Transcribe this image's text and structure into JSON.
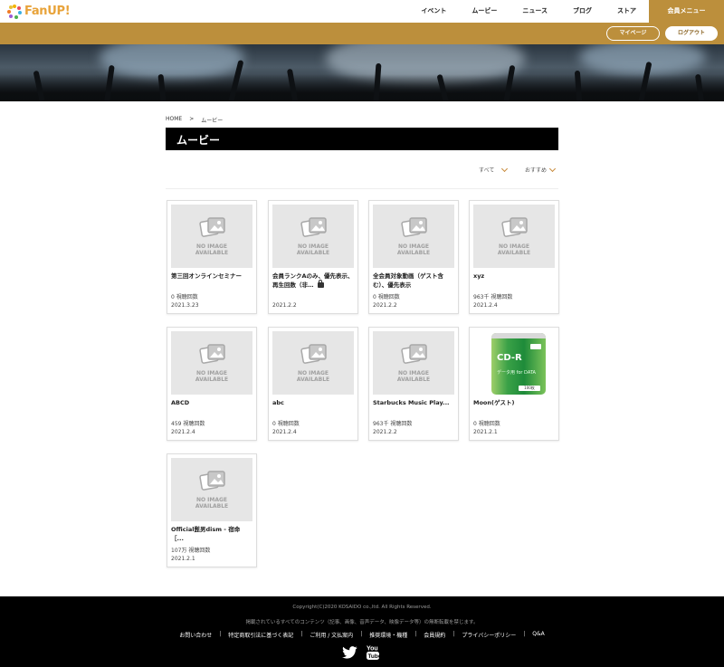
{
  "header": {
    "logo_text": "FanUP!",
    "nav": [
      "イベント",
      "ムービー",
      "ニュース",
      "ブログ",
      "ストア"
    ],
    "member_menu": "会員メニュー",
    "mypage": "マイページ",
    "logout": "ログアウト"
  },
  "breadcrumb": {
    "home": "HOME",
    "sep": ">",
    "current": "ムービー"
  },
  "page_title": "ムービー",
  "filters": {
    "category": "すべて",
    "sort": "おすすめ"
  },
  "no_image": {
    "line1": "NO IMAGE",
    "line2": "AVAILABLE"
  },
  "cards": [
    {
      "title": "第三回オンラインセミナー",
      "views": "0 視聴回数",
      "date": "2021.3.23"
    },
    {
      "title": "会員ランクAのみ、優先表示、再生回数（非…",
      "views": "",
      "date": "2021.2.2"
    },
    {
      "title": "全会員対象動画（ゲスト含む）、優先表示",
      "views": "0 視聴回数",
      "date": "2021.2.2"
    },
    {
      "title": "xyz",
      "views": "963千 視聴回数",
      "date": "2021.2.4"
    },
    {
      "title": "ABCD",
      "views": "459 視聴回数",
      "date": "2021.2.4"
    },
    {
      "title": "abc",
      "views": "0 視聴回数",
      "date": "2021.2.4"
    },
    {
      "title": "Starbucks Music Play...",
      "views": "963千 視聴回数",
      "date": "2021.2.2"
    },
    {
      "title": "Moon(ゲスト)",
      "views": "0 視聴回数",
      "date": "2021.2.1"
    },
    {
      "title": "Official髭男dism - 宿命［...",
      "views": "107万 視聴回数",
      "date": "2021.2.1"
    }
  ],
  "cdr_product": {
    "label": "CD-R",
    "text": "データ用 for DATA",
    "count": "100枚"
  },
  "footer": {
    "copyright": "Copyright(C)2020 KOSAIDO co.,ltd. All Rights Reserved.",
    "notice": "掲載されているすべてのコンテンツ（記事、画像、音声データ、映像データ等）の無断転載を禁じます。",
    "links": [
      "お問い合わせ",
      "特定商取引法に基づく表記",
      "ご利用 / 文払案内",
      "推奨環境・機種",
      "会員規約",
      "プライバシーポリシー",
      "Q&A"
    ],
    "link_sep": "|"
  },
  "colors": {
    "brand_gold": "#bc8f3c",
    "logo_orange": "#e8a33a",
    "twitter": "#ffffff",
    "youtube": "#ffffff"
  },
  "icons": [
    "logo-mark-icon",
    "chevron-down-icon",
    "no-image-icon",
    "lock-icon",
    "twitter-icon",
    "youtube-icon"
  ]
}
